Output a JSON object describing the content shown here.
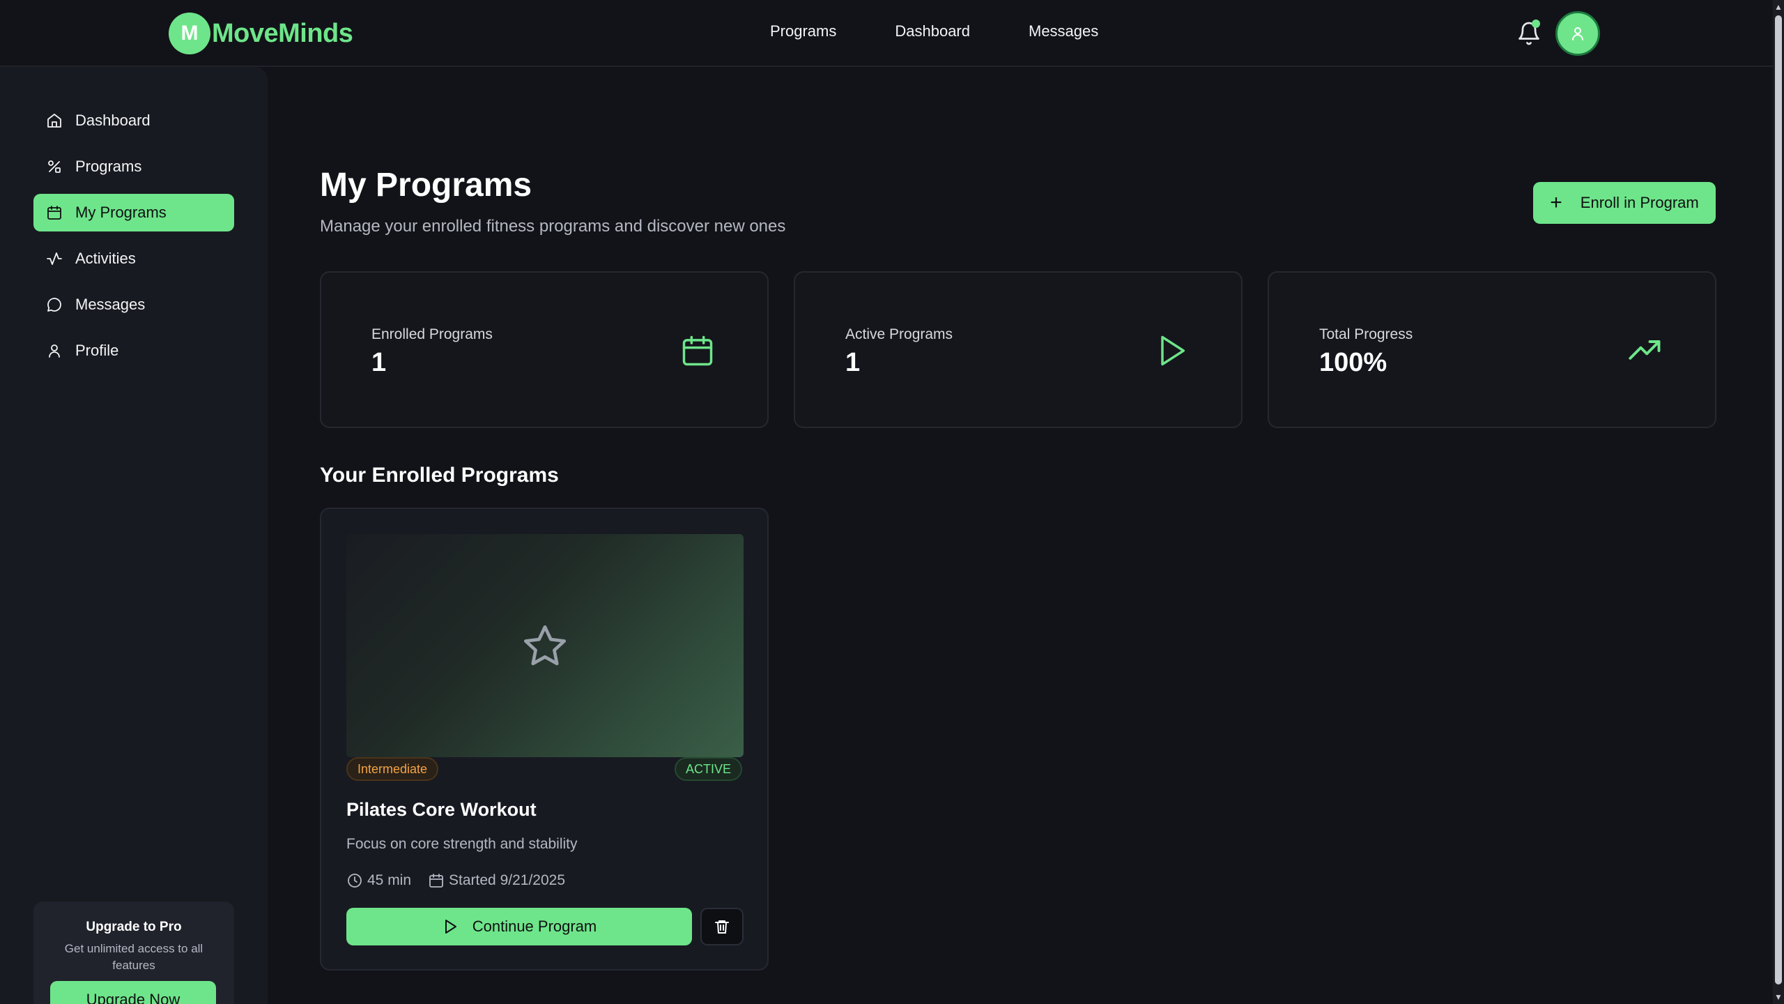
{
  "brand": {
    "badge_letter": "M",
    "name": "MoveMinds"
  },
  "topnav": {
    "items": [
      "Programs",
      "Dashboard",
      "Messages"
    ]
  },
  "sidebar": {
    "items": [
      {
        "label": "Dashboard",
        "icon": "home-icon",
        "active": false
      },
      {
        "label": "Programs",
        "icon": "programs-icon",
        "active": false
      },
      {
        "label": "My Programs",
        "icon": "calendar-icon",
        "active": true
      },
      {
        "label": "Activities",
        "icon": "activity-icon",
        "active": false
      },
      {
        "label": "Messages",
        "icon": "message-icon",
        "active": false
      },
      {
        "label": "Profile",
        "icon": "user-icon",
        "active": false
      }
    ],
    "upgrade": {
      "title": "Upgrade to Pro",
      "description": "Get unlimited access to all features",
      "button": "Upgrade Now"
    }
  },
  "page": {
    "title": "My Programs",
    "subtitle": "Manage your enrolled fitness programs and discover new ones",
    "enroll_button": "Enroll in Program"
  },
  "stats": [
    {
      "label": "Enrolled Programs",
      "value": "1",
      "icon": "calendar-icon"
    },
    {
      "label": "Active Programs",
      "value": "1",
      "icon": "play-icon"
    },
    {
      "label": "Total Progress",
      "value": "100%",
      "icon": "trending-up-icon"
    }
  ],
  "enrolled": {
    "section_title": "Your Enrolled Programs",
    "programs": [
      {
        "level": "Intermediate",
        "status": "ACTIVE",
        "title": "Pilates Core Workout",
        "description": "Focus on core strength and stability",
        "duration": "45 min",
        "started": "Started 9/21/2025",
        "continue_label": "Continue Program"
      }
    ]
  },
  "colors": {
    "accent": "#6ee58a",
    "background": "#121318",
    "level_badge": "#f2a444"
  }
}
